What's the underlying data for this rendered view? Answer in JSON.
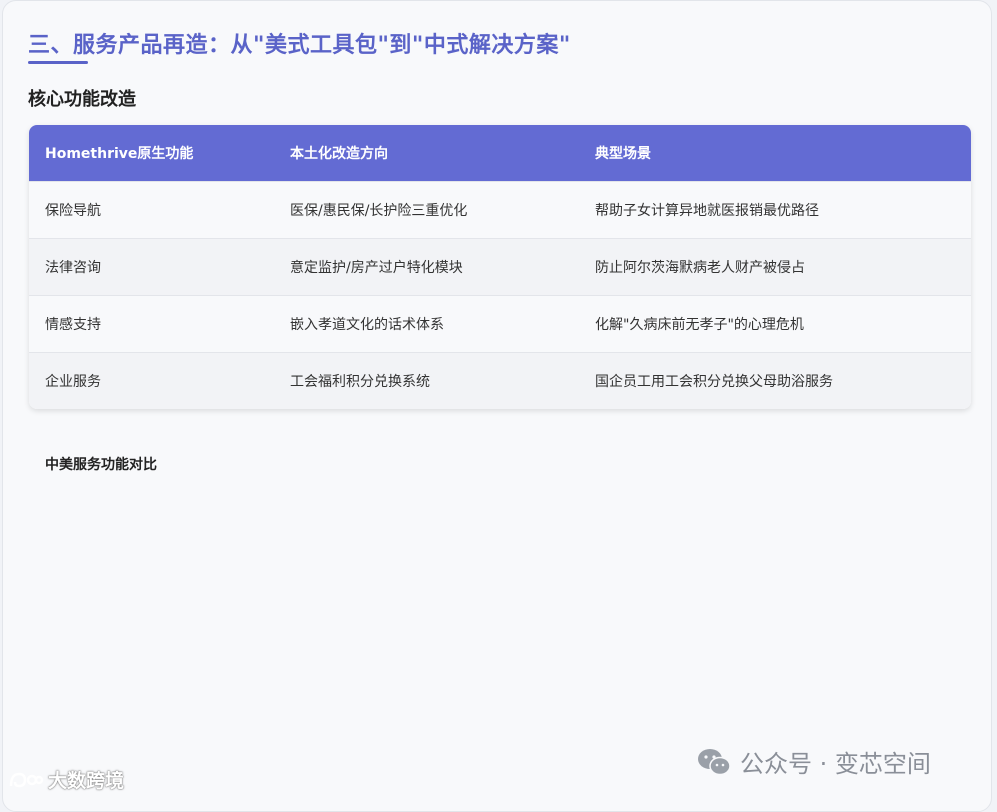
{
  "section": {
    "title": "三、服务产品再造：从\"美式工具包\"到\"中式解决方案\"",
    "subtitle": "核心功能改造"
  },
  "table": {
    "headers": [
      "Homethrive原生功能",
      "本土化改造方向",
      "典型场景"
    ],
    "rows": [
      [
        "保险导航",
        "医保/惠民保/长护险三重优化",
        "帮助子女计算异地就医报销最优路径"
      ],
      [
        "法律咨询",
        "意定监护/房产过户特化模块",
        "防止阿尔茨海默病老人财产被侵占"
      ],
      [
        "情感支持",
        "嵌入孝道文化的话术体系",
        "化解\"久病床前无孝子\"的心理危机"
      ],
      [
        "企业服务",
        "工会福利积分兑换系统",
        "国企员工用工会积分兑换父母助浴服务"
      ]
    ]
  },
  "chart_caption": "中美服务功能对比",
  "watermarks": {
    "right": "公众号 · 变芯空间",
    "left": "大数跨境"
  },
  "colors": {
    "accent": "#5a63c8",
    "header_bg": "#636bd3"
  },
  "icons": [
    "wechat-icon",
    "logo-icon"
  ]
}
